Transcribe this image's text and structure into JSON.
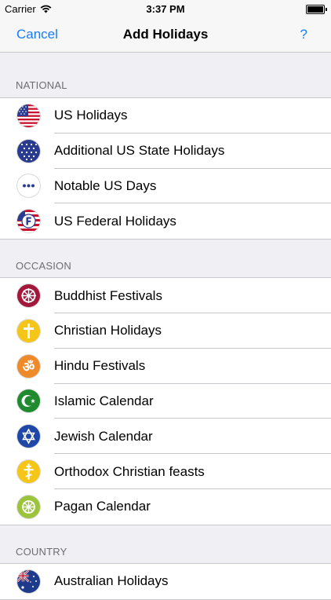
{
  "status": {
    "carrier": "Carrier",
    "time": "3:37 PM"
  },
  "navbar": {
    "cancel": "Cancel",
    "title": "Add Holidays",
    "help": "?"
  },
  "sections": [
    {
      "header": "NATIONAL",
      "items": [
        {
          "label": "US Holidays",
          "icon": "us-flag-icon"
        },
        {
          "label": "Additional US State Holidays",
          "icon": "stars-icon"
        },
        {
          "label": "Notable US Days",
          "icon": "dots-icon"
        },
        {
          "label": "US Federal Holidays",
          "icon": "federal-f-icon"
        }
      ]
    },
    {
      "header": "OCCASION",
      "items": [
        {
          "label": "Buddhist Festivals",
          "icon": "dharma-wheel-icon"
        },
        {
          "label": "Christian Holidays",
          "icon": "cross-icon"
        },
        {
          "label": "Hindu Festivals",
          "icon": "om-icon"
        },
        {
          "label": "Islamic Calendar",
          "icon": "crescent-star-icon"
        },
        {
          "label": "Jewish Calendar",
          "icon": "star-of-david-icon"
        },
        {
          "label": "Orthodox Christian feasts",
          "icon": "orthodox-cross-icon"
        },
        {
          "label": "Pagan Calendar",
          "icon": "wheel-icon"
        }
      ]
    },
    {
      "header": "COUNTRY",
      "items": [
        {
          "label": "Australian Holidays",
          "icon": "australia-flag-icon"
        }
      ]
    }
  ],
  "colors": {
    "accent": "#1a7cf5",
    "background": "#efeff4",
    "separator": "#c8c7cc"
  }
}
